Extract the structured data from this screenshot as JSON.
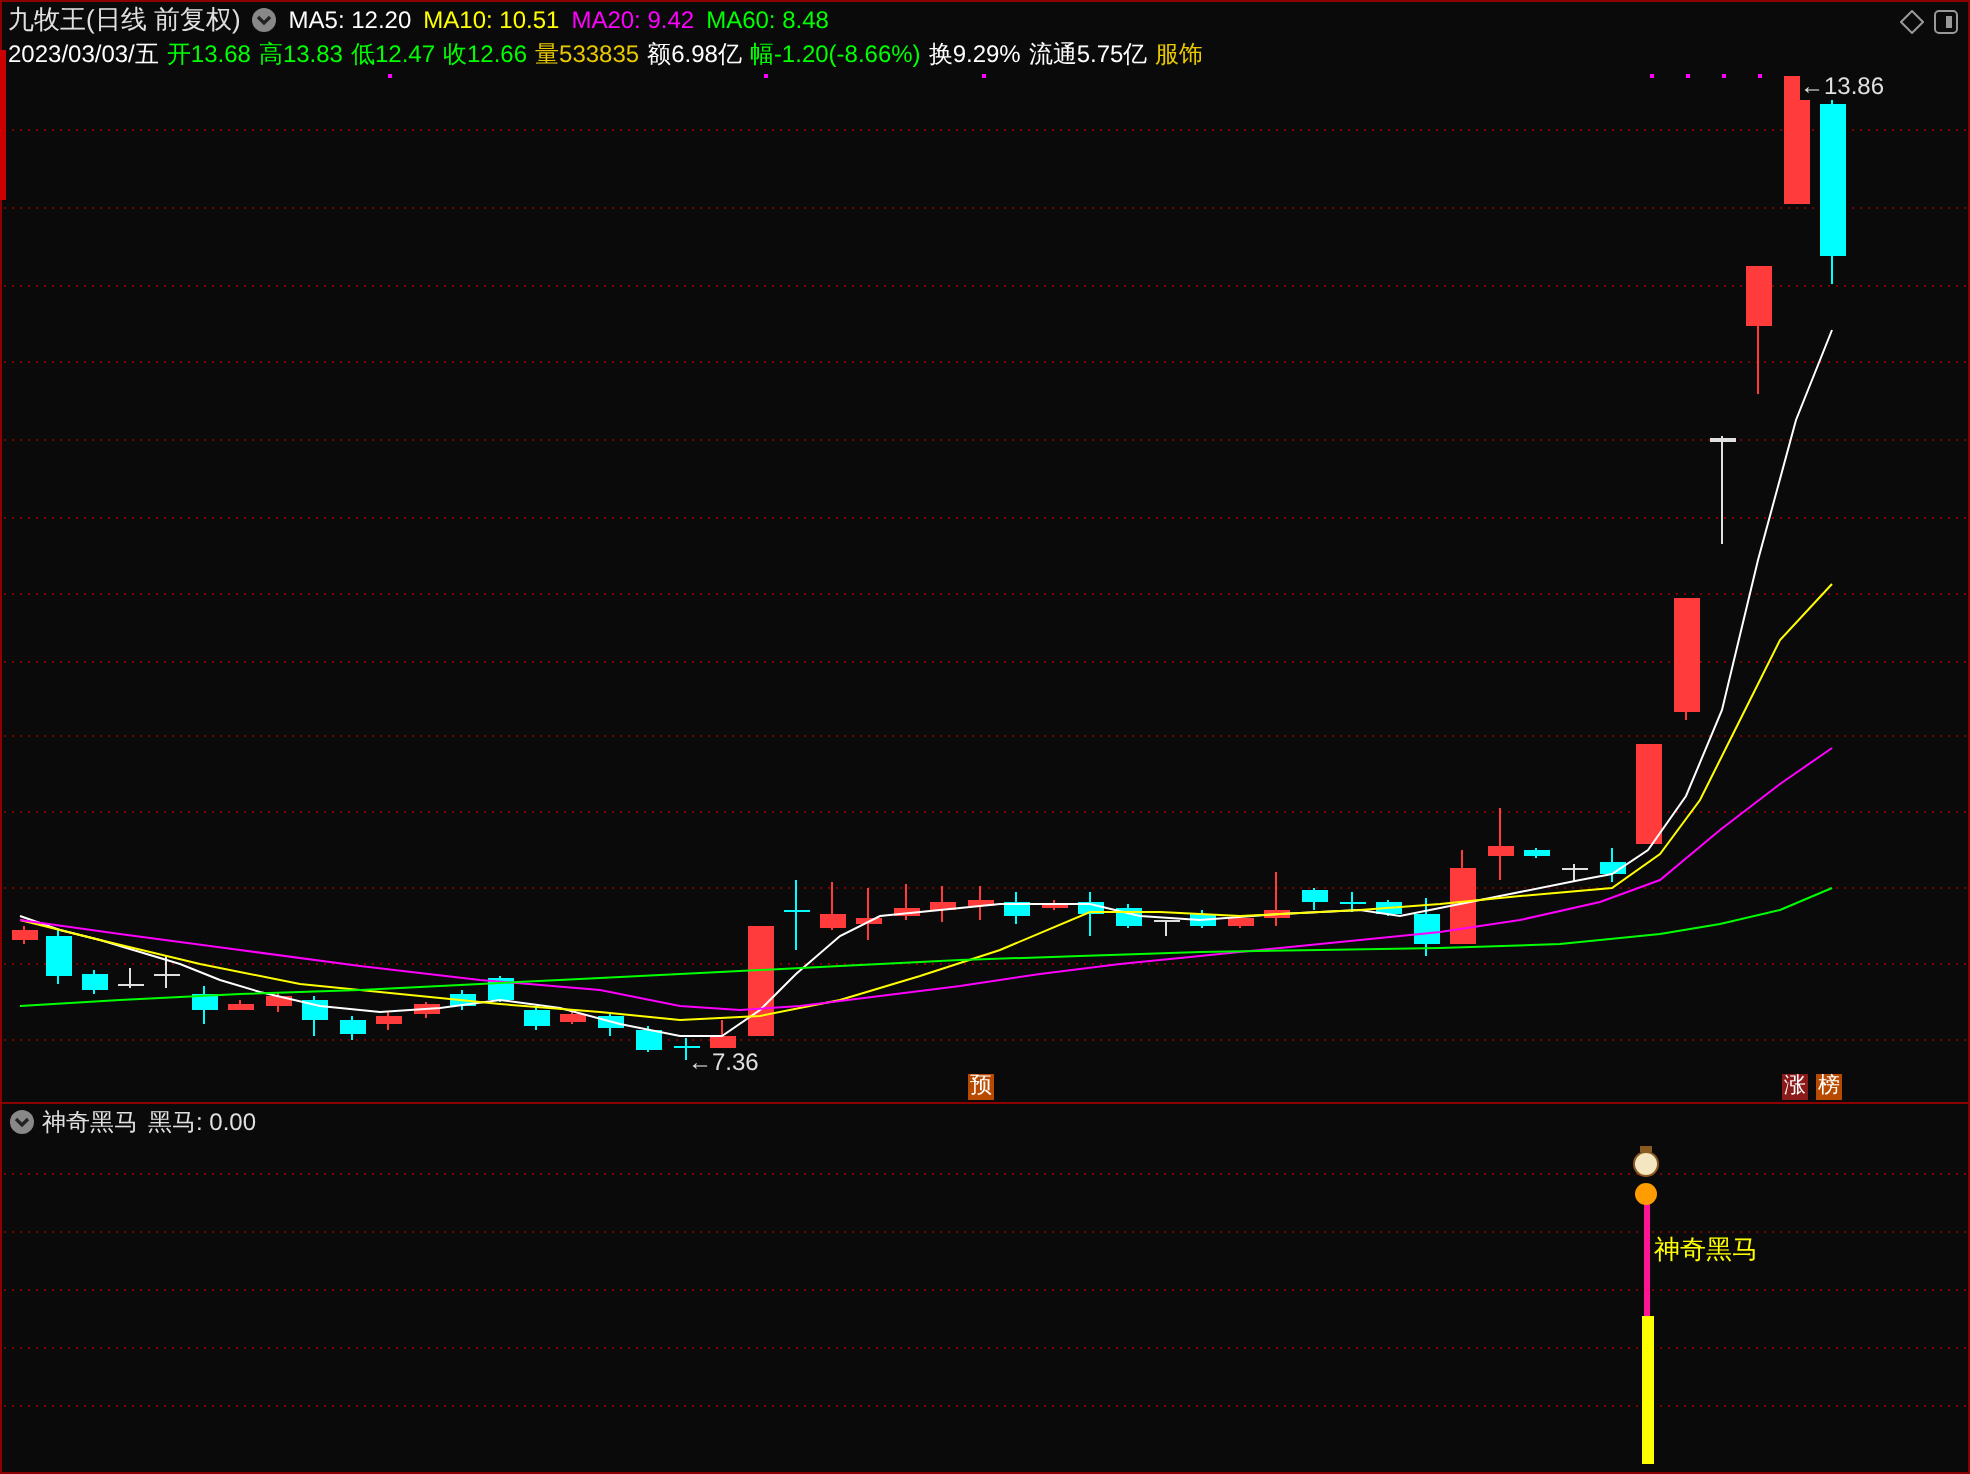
{
  "header": {
    "title": "九牧王(日线 前复权)",
    "ma": [
      {
        "label": "MA5: 12.20",
        "color": "#ffffff"
      },
      {
        "label": "MA10: 10.51",
        "color": "#ffff00"
      },
      {
        "label": "MA20: 9.42",
        "color": "#ff00ff"
      },
      {
        "label": "MA60: 8.48",
        "color": "#00ff00"
      }
    ]
  },
  "quote": [
    {
      "text": "2023/03/03/五",
      "color": "#ffffff"
    },
    {
      "text": "开13.68",
      "color": "#00ff00"
    },
    {
      "text": "高13.83",
      "color": "#00ff00"
    },
    {
      "text": "低12.47",
      "color": "#00ff00"
    },
    {
      "text": "收12.66",
      "color": "#00ff00"
    },
    {
      "text": "量533835",
      "color": "#e8c800"
    },
    {
      "text": "额6.98亿",
      "color": "#ffffff"
    },
    {
      "text": "幅-1.20(-8.66%)",
      "color": "#00ff00"
    },
    {
      "text": "换9.29%",
      "color": "#ffffff"
    },
    {
      "text": "流通5.75亿",
      "color": "#ffffff"
    },
    {
      "text": "服饰",
      "color": "#e8c800"
    }
  ],
  "price_labels": [
    {
      "kind": "high",
      "text": "←13.86"
    },
    {
      "kind": "low",
      "text": "←7.36"
    }
  ],
  "markers": [
    {
      "text": "预"
    },
    {
      "text": "涨"
    },
    {
      "text": "榜"
    }
  ],
  "indicator": {
    "title": "神奇黑马",
    "readout": "黑马: 0.00",
    "signal_label": "神奇黑马"
  }
}
